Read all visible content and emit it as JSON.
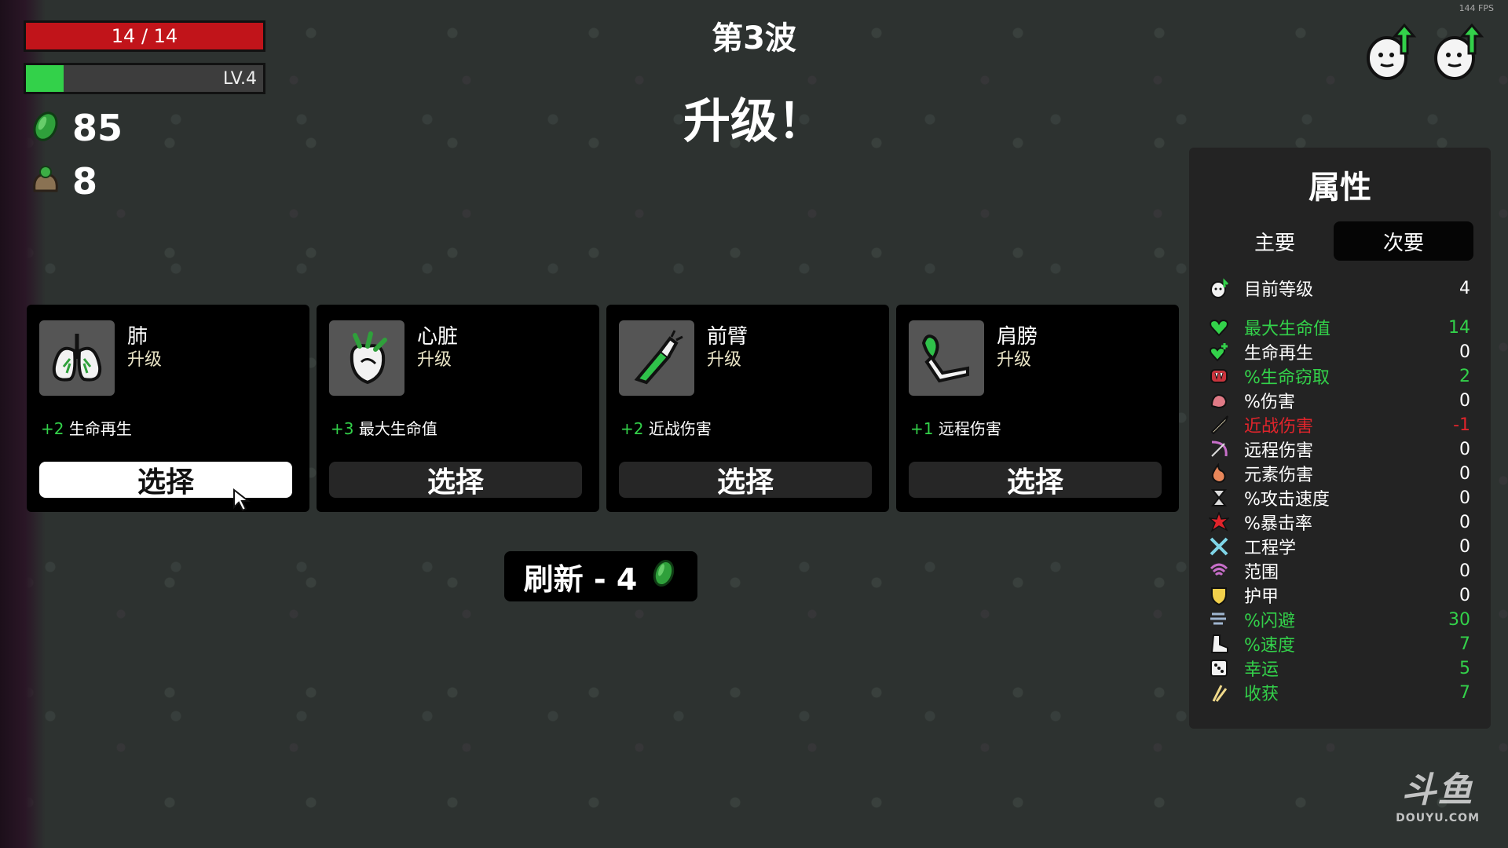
{
  "fps": "144 FPS",
  "hud": {
    "hp_text": "14 / 14",
    "hp_fraction": 1.0,
    "level_text": "LV.4",
    "xp_fraction": 0.16,
    "materials": "85",
    "bag_count": "8"
  },
  "wave_title": "第3波",
  "levelup_title": "升级！",
  "pending_levelups": 2,
  "cards": [
    {
      "name": "肺",
      "subtitle": "升级",
      "effect_plus": "+2",
      "effect_text": "生命再生",
      "button": "选择",
      "icon": "lungs-icon",
      "active": true
    },
    {
      "name": "心脏",
      "subtitle": "升级",
      "effect_plus": "+3",
      "effect_text": "最大生命值",
      "button": "选择",
      "icon": "heart-organ-icon",
      "active": false
    },
    {
      "name": "前臂",
      "subtitle": "升级",
      "effect_plus": "+2",
      "effect_text": "近战伤害",
      "button": "选择",
      "icon": "forearm-icon",
      "active": false
    },
    {
      "name": "肩膀",
      "subtitle": "升级",
      "effect_plus": "+1",
      "effect_text": "远程伤害",
      "button": "选择",
      "icon": "shoulder-icon",
      "active": false
    }
  ],
  "reroll": {
    "label": "刷新 - 4"
  },
  "stats": {
    "title": "属性",
    "tab_primary": "主要",
    "tab_secondary": "次要",
    "level_row": {
      "label": "目前等级",
      "value": "4",
      "color": "white"
    },
    "rows": [
      {
        "label": "最大生命值",
        "value": "14",
        "color": "green",
        "icon": "heart-icon"
      },
      {
        "label": "生命再生",
        "value": "0",
        "color": "white",
        "icon": "heart-plus-icon"
      },
      {
        "label": "%生命窃取",
        "value": "2",
        "color": "green",
        "icon": "fangs-icon"
      },
      {
        "label": "%伤害",
        "value": "0",
        "color": "white",
        "icon": "muscle-icon"
      },
      {
        "label": "近战伤害",
        "value": "-1",
        "color": "red",
        "icon": "sword-icon"
      },
      {
        "label": "远程伤害",
        "value": "0",
        "color": "white",
        "icon": "bow-icon"
      },
      {
        "label": "元素伤害",
        "value": "0",
        "color": "white",
        "icon": "flame-icon"
      },
      {
        "label": "%攻击速度",
        "value": "0",
        "color": "white",
        "icon": "hourglass-icon"
      },
      {
        "label": "%暴击率",
        "value": "0",
        "color": "white",
        "icon": "crit-icon"
      },
      {
        "label": "工程学",
        "value": "0",
        "color": "white",
        "icon": "wrench-icon"
      },
      {
        "label": "范围",
        "value": "0",
        "color": "white",
        "icon": "range-icon"
      },
      {
        "label": "护甲",
        "value": "0",
        "color": "white",
        "icon": "shield-icon"
      },
      {
        "label": "%闪避",
        "value": "30",
        "color": "green",
        "icon": "dodge-icon"
      },
      {
        "label": "%速度",
        "value": "7",
        "color": "green",
        "icon": "boot-icon"
      },
      {
        "label": "幸运",
        "value": "5",
        "color": "green",
        "icon": "dice-icon"
      },
      {
        "label": "收获",
        "value": "7",
        "color": "green",
        "icon": "wheat-icon"
      }
    ]
  },
  "watermark": {
    "big": "斗鱼",
    "small": "DOUYU.COM"
  }
}
